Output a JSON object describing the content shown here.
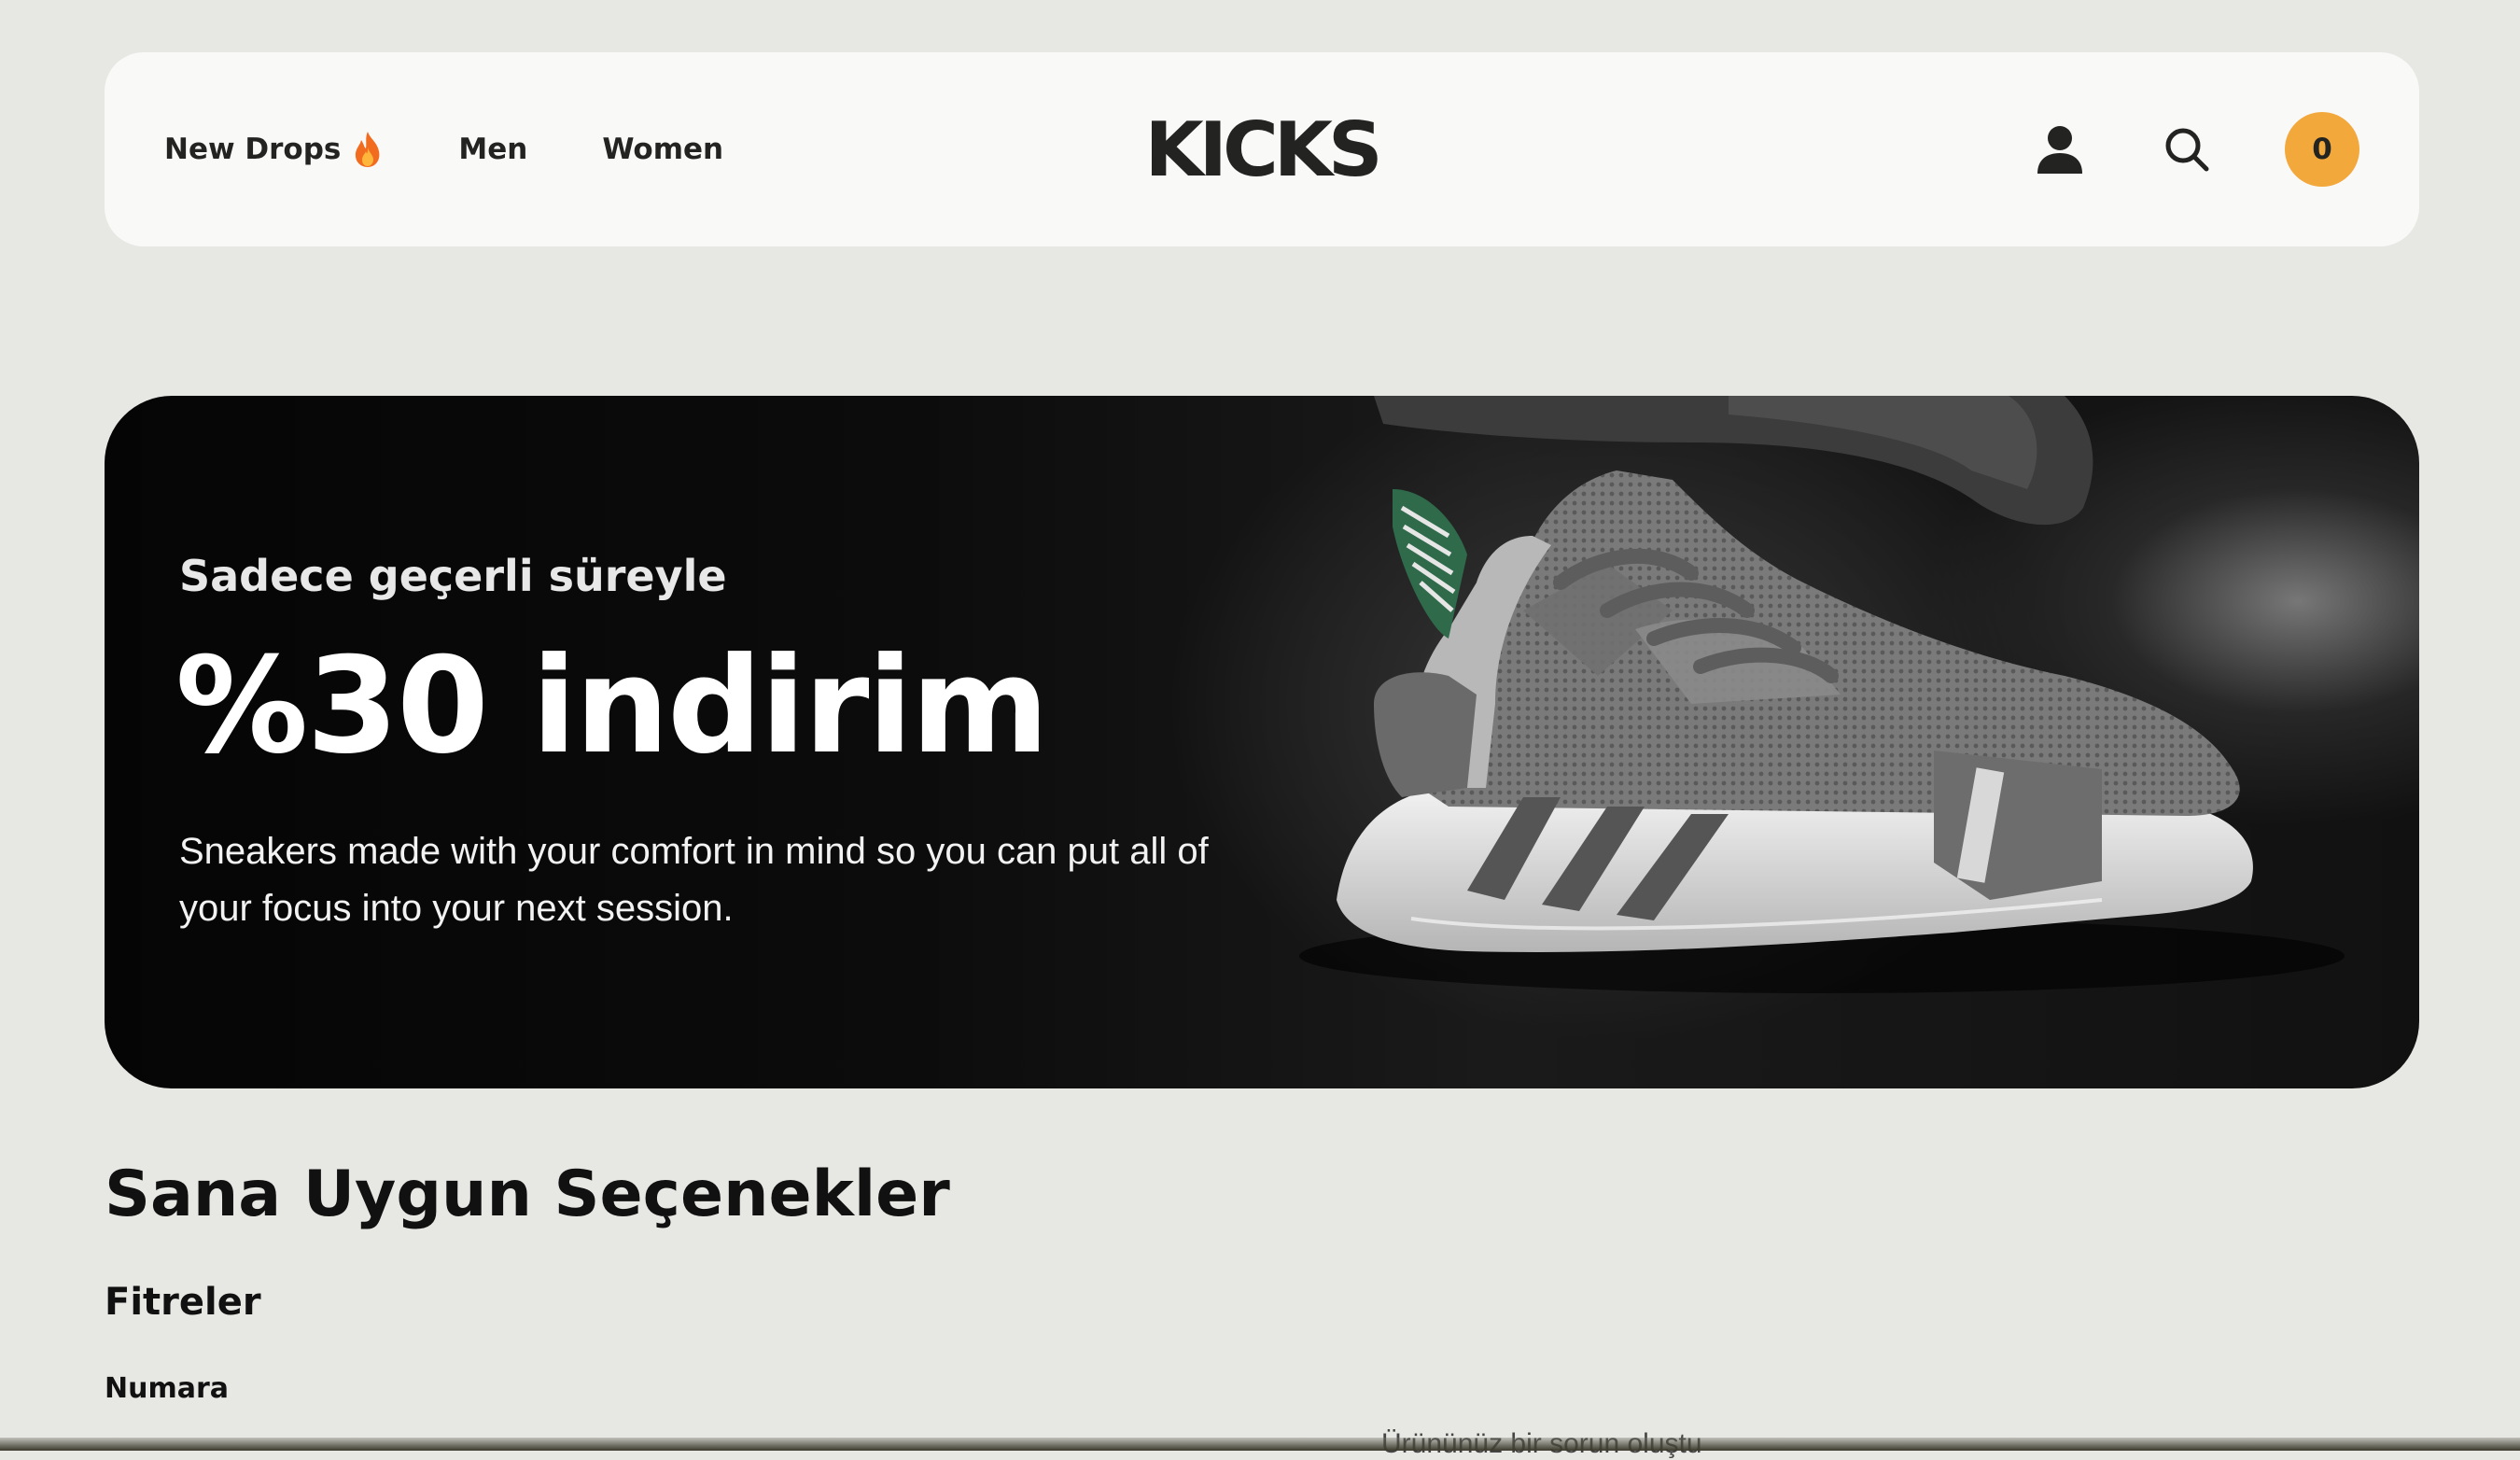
{
  "nav": {
    "links": [
      {
        "label": "New Drops",
        "icon": "fire-icon"
      },
      {
        "label": "Men"
      },
      {
        "label": "Women"
      }
    ],
    "logo": "KICKS",
    "user_icon": "user-icon",
    "search_icon": "search-icon",
    "cart_count": "0"
  },
  "hero": {
    "subtitle": "Sadece geçerli süreyle",
    "title": "%30 indirim",
    "description": "Sneakers made with your comfort in mind so you can put all of your focus into your next session.",
    "image": "sneaker-product-image"
  },
  "main": {
    "section_title": "Sana Uygun Seçenekler",
    "filters_title": "Fitreler",
    "filter_size_label": "Numara",
    "partial_text": "Ürününüz bir sorun oluştu"
  },
  "colors": {
    "background": "#e7e7e3",
    "navbar": "#f9f9f8",
    "accent": "#f2a83b",
    "text": "#232321",
    "hero_bg": "#0a0a0a"
  }
}
